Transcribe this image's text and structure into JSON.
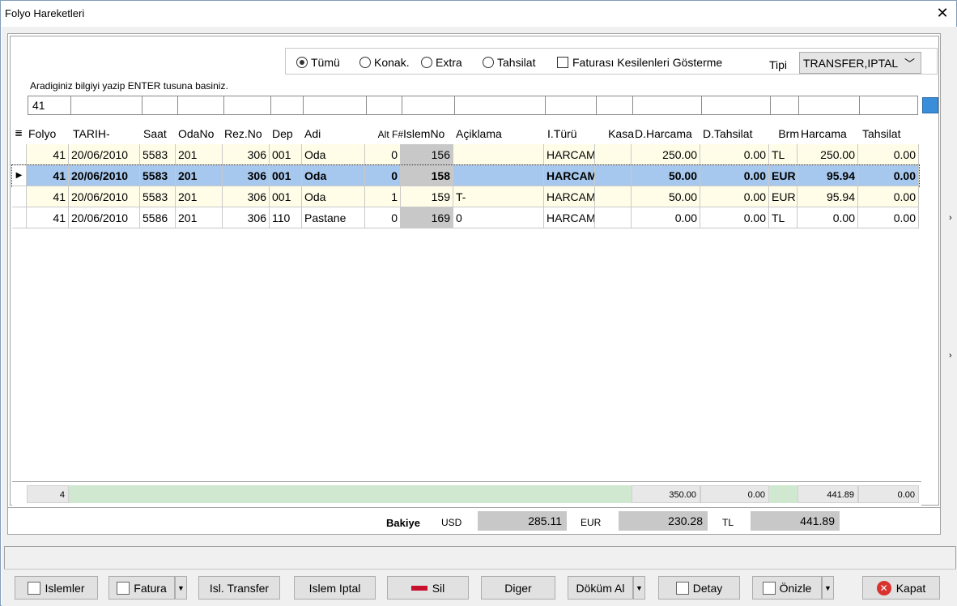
{
  "window": {
    "title": "Folyo Hareketleri"
  },
  "filter": {
    "radios": [
      {
        "label": "Tümü",
        "checked": true
      },
      {
        "label": "Konak.",
        "checked": false
      },
      {
        "label": "Extra",
        "checked": false
      },
      {
        "label": "Tahsilat",
        "checked": false
      }
    ],
    "checkbox_label": "Faturası Kesilenleri Gösterme",
    "tipi_label": "Tipi",
    "tipi_value": "TRANSFER,IPTAL"
  },
  "search": {
    "hint": "Aradiginiz bilgiyi yazip ENTER tusuna basiniz.",
    "value": "41"
  },
  "grid": {
    "headers": [
      "Folyo",
      "TARIH-",
      "Saat",
      "OdaNo",
      "Rez.No",
      "Dep",
      "Adi",
      "Alt F#",
      "IslemNo",
      "Açiklama",
      "I.Türü",
      "Kasa",
      "D.Harcama",
      "D.Tahsilat",
      "Brm",
      "Harcama",
      "Tahsilat"
    ],
    "rows": [
      {
        "cells": [
          "41",
          "20/06/2010",
          "5583",
          "201",
          "306",
          "001",
          "Oda",
          "0",
          "156",
          "",
          "HARCAM",
          "",
          "250.00",
          "0.00",
          "TL",
          "250.00",
          "0.00"
        ],
        "selected": false
      },
      {
        "cells": [
          "41",
          "20/06/2010",
          "5583",
          "201",
          "306",
          "001",
          "Oda",
          "0",
          "158",
          "",
          "HARCAM",
          "",
          "50.00",
          "0.00",
          "EUR",
          "95.94",
          "0.00"
        ],
        "selected": true
      },
      {
        "cells": [
          "41",
          "20/06/2010",
          "5583",
          "201",
          "306",
          "001",
          "Oda",
          "1",
          "159",
          "T-",
          "HARCAM",
          "",
          "50.00",
          "0.00",
          "EUR",
          "95.94",
          "0.00"
        ],
        "selected": false
      },
      {
        "cells": [
          "41",
          "20/06/2010",
          "5586",
          "201",
          "306",
          "110",
          "Pastane",
          "0",
          "169",
          "0",
          "HARCAM",
          "",
          "0.00",
          "0.00",
          "TL",
          "0.00",
          "0.00"
        ],
        "selected": false
      }
    ]
  },
  "totals": {
    "count": "4",
    "d_harcama": "350.00",
    "d_tahsilat": "0.00",
    "harcama": "441.89",
    "tahsilat": "0.00"
  },
  "bakiye": {
    "label": "Bakiye",
    "usd_label": "USD",
    "usd": "285.11",
    "eur_label": "EUR",
    "eur": "230.28",
    "tl_label": "TL",
    "tl": "441.89"
  },
  "buttons": {
    "islemler": "Islemler",
    "fatura": "Fatura",
    "transfer": "Isl. Transfer",
    "iptal": "Islem Iptal",
    "sil": "Sil",
    "diger": "Diger",
    "dokum": "Döküm Al",
    "detay": "Detay",
    "onizle": "Önizle",
    "kapat": "Kapat"
  }
}
